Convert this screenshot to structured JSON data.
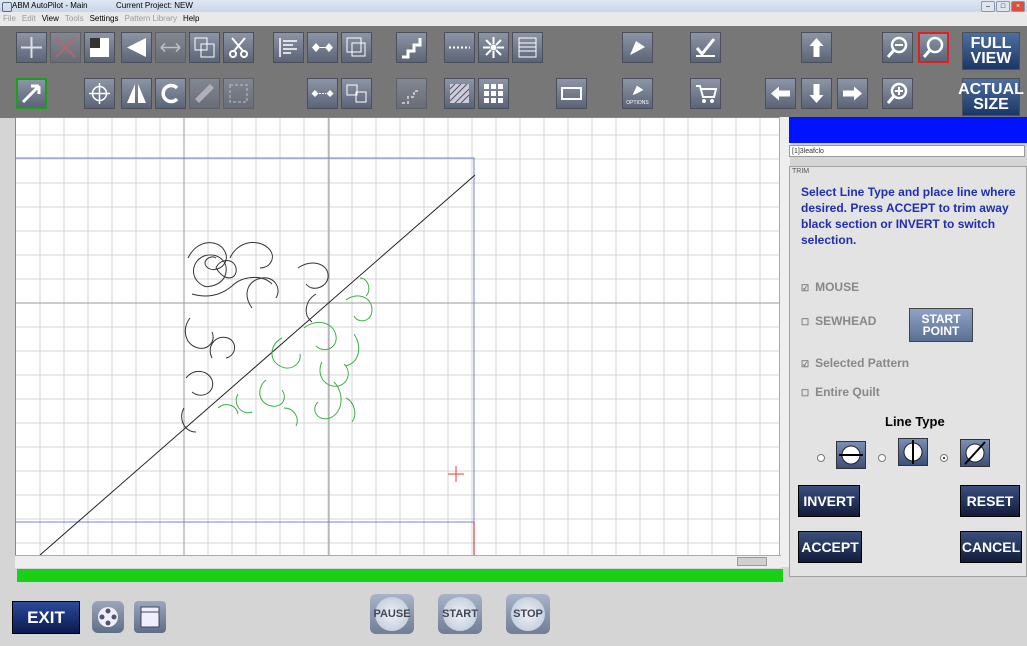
{
  "window": {
    "app_title": "ABM AutoPilot - Main",
    "project": "Current Project: NEW",
    "controls": [
      "–",
      "□",
      "×"
    ]
  },
  "menu": [
    {
      "label": "File",
      "enabled": false
    },
    {
      "label": "Edit",
      "enabled": false
    },
    {
      "label": "View",
      "enabled": true
    },
    {
      "label": "Tools",
      "enabled": false
    },
    {
      "label": "Settings",
      "enabled": true
    },
    {
      "label": "Pattern Library",
      "enabled": false
    },
    {
      "label": "Help",
      "enabled": true
    }
  ],
  "toolbar": {
    "full_view": [
      "FULL",
      "VIEW"
    ],
    "actual_size": [
      "ACTUAL",
      "SIZE"
    ],
    "options_label": "OPTIONS"
  },
  "side": {
    "layer_name": "[1]3leafclo",
    "panel_header": "TRIM",
    "instructions": "Select Line Type and place line where desired.  Press ACCEPT to trim away black section or INVERT to switch selection.",
    "options": {
      "mouse": "MOUSE",
      "sewhead": "SEWHEAD",
      "selected_pattern": "Selected Pattern",
      "entire_quilt": "Entire Quilt"
    },
    "start_point": [
      "START",
      "POINT"
    ],
    "line_type_title": "Line Type",
    "buttons": {
      "invert": "INVERT",
      "reset": "RESET",
      "accept": "ACCEPT",
      "cancel": "CANCEL"
    }
  },
  "bottom": {
    "exit": "EXIT",
    "pause": "PAUSE",
    "start": "START",
    "stop": "STOP"
  },
  "colors": {
    "progress": "#17d017",
    "accent_blue": "#0012ff",
    "instruction_text": "#1f2fae"
  }
}
